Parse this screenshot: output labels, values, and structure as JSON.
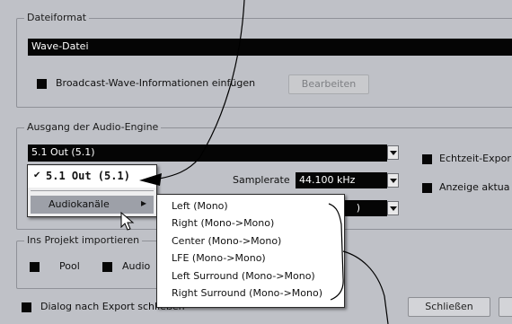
{
  "dateiformat": {
    "group_label": "Dateiformat",
    "format_value": "Wave-Datei",
    "broadcast_label": "Broadcast-Wave-Informationen einfügen",
    "edit_button": "Bearbeiten"
  },
  "ausgang": {
    "group_label": "Ausgang der Audio-Engine",
    "output_value": "5.1 Out (5.1)",
    "samplerate_label": "Samplerate",
    "samplerate_value": "44.100 kHz",
    "bitdepth_partial": ")",
    "realtime_label": "Echtzeit-Expor",
    "monitor_label": "Anzeige aktua"
  },
  "import": {
    "group_label": "Ins Projekt importieren",
    "pool_label": "Pool",
    "audio_label": "Audio"
  },
  "footer": {
    "dialog_close_label": "Dialog nach Export schließen",
    "close_button": "Schließen"
  },
  "output_popup": {
    "checkmark": "✔",
    "selected_item": "5.1 Out (5.1)",
    "submenu_label": "Audiokanäle",
    "submenu_arrow": "▸"
  },
  "channels_menu": {
    "items": [
      "Left (Mono)",
      "Right (Mono->Mono)",
      "Center (Mono->Mono)",
      "LFE (Mono->Mono)",
      "Left Surround (Mono->Mono)",
      "Right Surround (Mono->Mono)"
    ]
  }
}
